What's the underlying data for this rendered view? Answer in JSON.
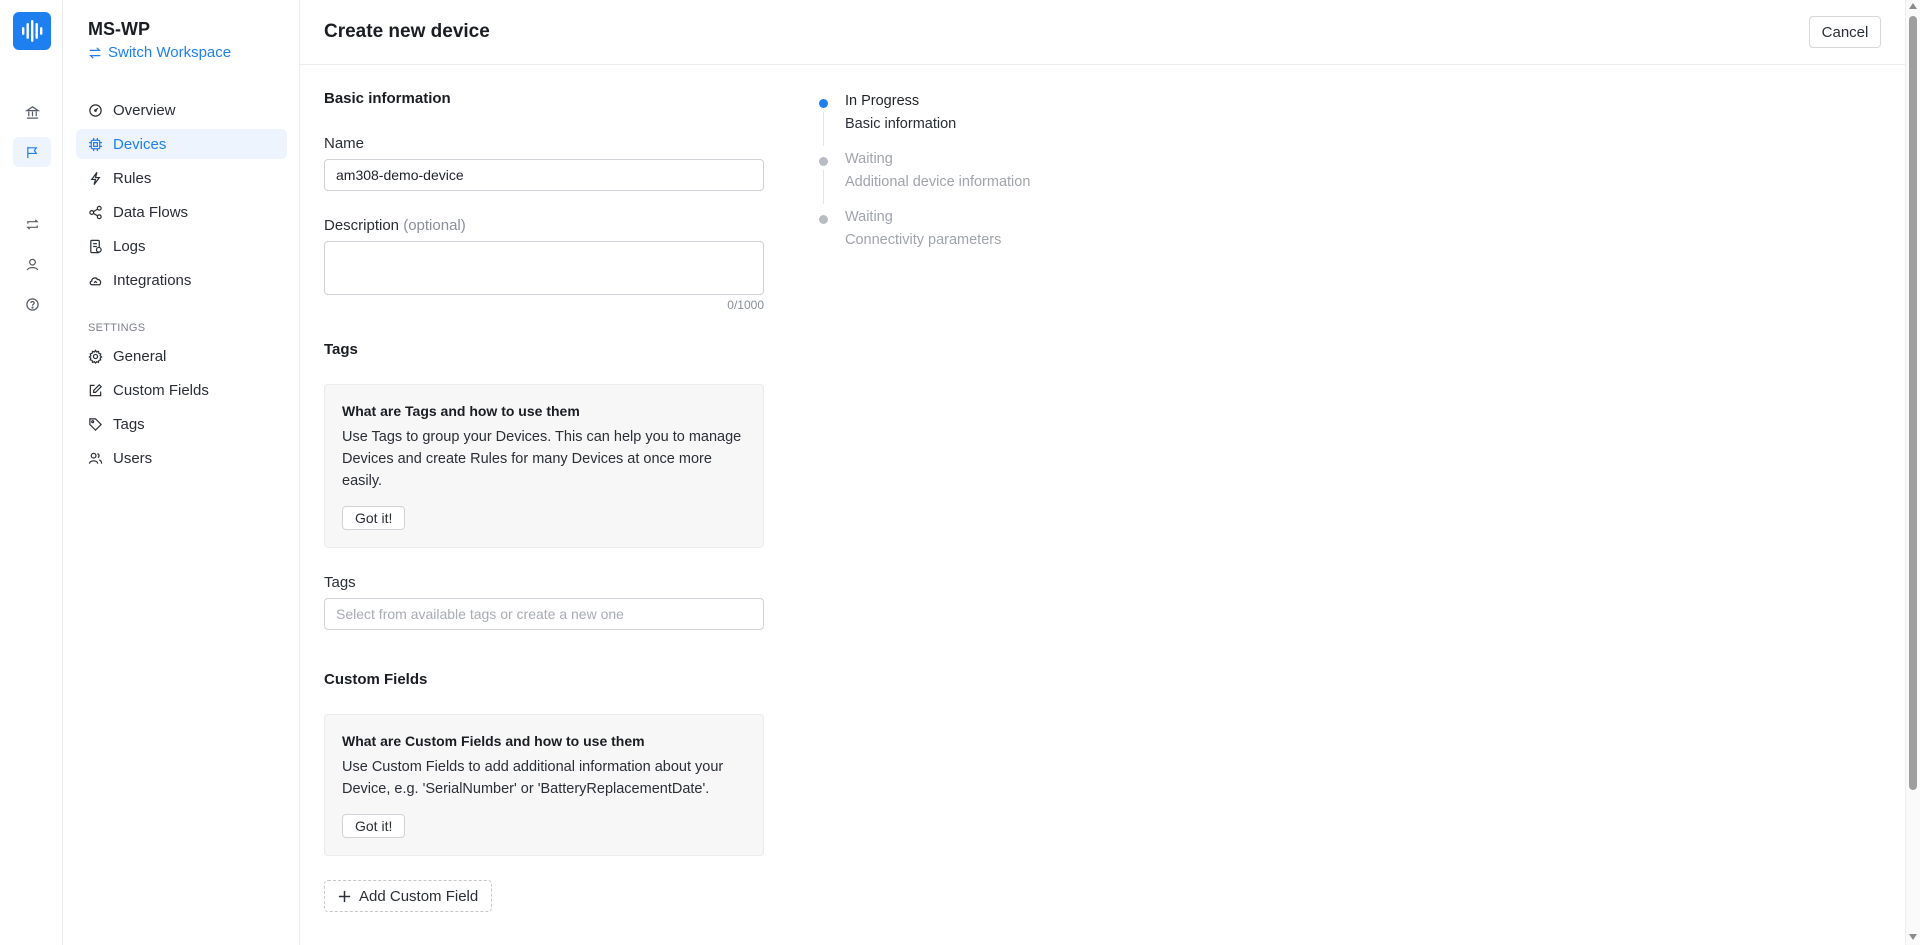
{
  "workspace": {
    "name": "MS-WP",
    "switch_label": "Switch Workspace"
  },
  "nav": {
    "items": [
      {
        "label": "Overview",
        "icon": "gauge-icon"
      },
      {
        "label": "Devices",
        "icon": "chip-icon",
        "active": true
      },
      {
        "label": "Rules",
        "icon": "bolt-icon"
      },
      {
        "label": "Data Flows",
        "icon": "share-icon"
      },
      {
        "label": "Logs",
        "icon": "log-icon"
      },
      {
        "label": "Integrations",
        "icon": "cloud-icon"
      }
    ],
    "settings_label": "SETTINGS",
    "settings_items": [
      {
        "label": "General",
        "icon": "gear-icon"
      },
      {
        "label": "Custom Fields",
        "icon": "edit-icon"
      },
      {
        "label": "Tags",
        "icon": "tag-icon"
      },
      {
        "label": "Users",
        "icon": "users-icon"
      }
    ]
  },
  "header": {
    "title": "Create new device",
    "cancel_label": "Cancel"
  },
  "form": {
    "basic_heading": "Basic information",
    "name_label": "Name",
    "name_value": "am308-demo-device",
    "description_label": "Description",
    "description_optional": "(optional)",
    "description_counter": "0/1000",
    "tags_heading": "Tags",
    "tags_info": {
      "title": "What are Tags and how to use them",
      "text": "Use Tags to group your Devices. This can help you to manage Devices and create Rules for many Devices at once more easily.",
      "button": "Got it!"
    },
    "tags_label": "Tags",
    "tags_placeholder": "Select from available tags or create a new one",
    "cf_heading": "Custom Fields",
    "cf_info": {
      "title": "What are Custom Fields and how to use them",
      "text": "Use Custom Fields to add additional information about your Device, e.g. 'SerialNumber' or 'BatteryReplacementDate'.",
      "button": "Got it!"
    },
    "add_cf_label": "Add Custom Field"
  },
  "steps": [
    {
      "status": "In Progress",
      "label": "Basic information",
      "active": true
    },
    {
      "status": "Waiting",
      "label": "Additional device information"
    },
    {
      "status": "Waiting",
      "label": "Connectivity parameters"
    }
  ],
  "colors": {
    "accent": "#1e7ff0",
    "active_bg": "#eef4fe"
  }
}
